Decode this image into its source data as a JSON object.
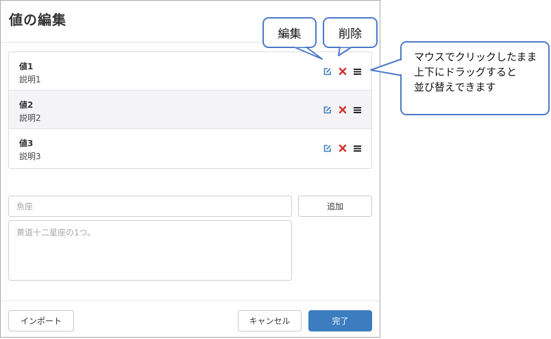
{
  "dialog": {
    "title": "値の編集",
    "items": [
      {
        "name": "値1",
        "description": "説明1"
      },
      {
        "name": "値2",
        "description": "説明2"
      },
      {
        "name": "値3",
        "description": "説明3"
      }
    ],
    "form": {
      "name_placeholder": "魚座",
      "description_placeholder": "黄道十二星座の1つ。",
      "add_label": "追加"
    },
    "footer": {
      "import_label": "インポート",
      "cancel_label": "キャンセル",
      "done_label": "完了"
    }
  },
  "callouts": {
    "edit": "編集",
    "delete": "削除",
    "drag": [
      "マウスでクリックしたまま",
      "上下にドラッグすると",
      "並び替えできます"
    ]
  },
  "icons": {
    "edit": "edit-icon",
    "delete": "delete-icon",
    "drag": "drag-handle-icon"
  },
  "colors": {
    "primary": "#3b7dbf",
    "edit_icon": "#3b7dbf",
    "delete_icon": "#d0312d",
    "callout_border": "#4a78c8"
  }
}
